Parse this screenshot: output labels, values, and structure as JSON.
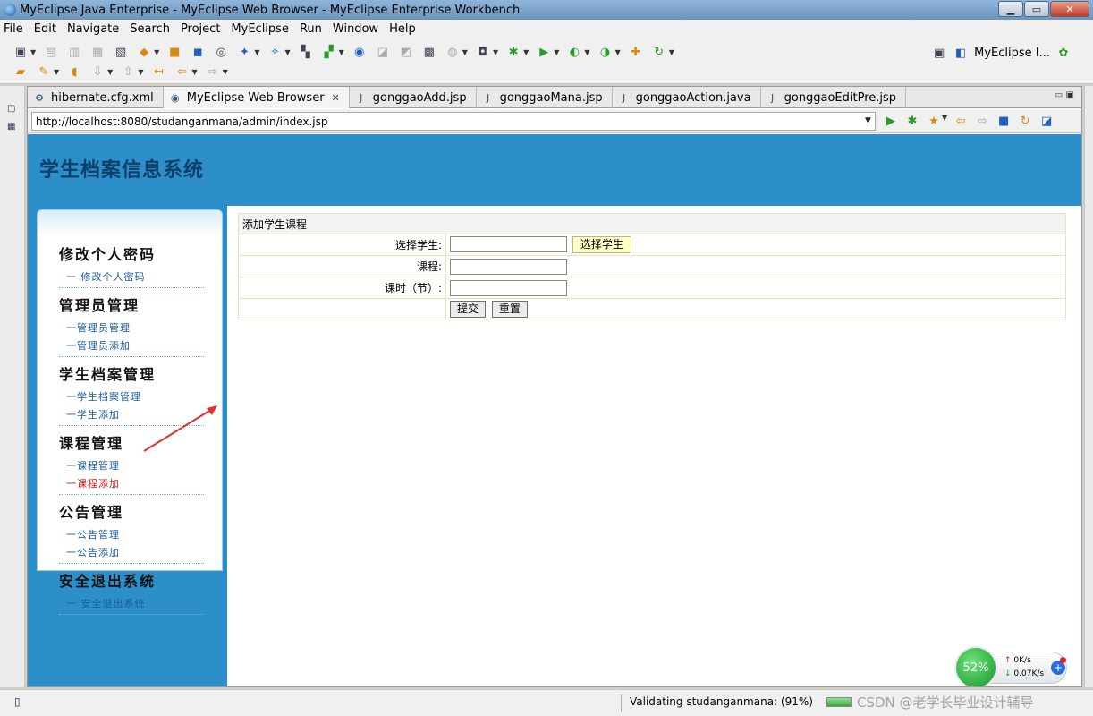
{
  "window": {
    "title": "MyEclipse Java Enterprise - MyEclipse Web Browser - MyEclipse Enterprise Workbench",
    "min_label": "▁",
    "max_label": "▭",
    "close_label": "✕"
  },
  "menu": [
    "File",
    "Edit",
    "Navigate",
    "Search",
    "Project",
    "MyEclipse",
    "Run",
    "Window",
    "Help"
  ],
  "perspective": {
    "label": "MyEclipse I..."
  },
  "tabs": [
    {
      "label": "hibernate.cfg.xml",
      "icon": "gear-icon"
    },
    {
      "label": "MyEclipse Web Browser",
      "icon": "globe-icon",
      "active": true
    },
    {
      "label": "gonggaoAdd.jsp",
      "icon": "jsp-file-icon"
    },
    {
      "label": "gonggaoMana.jsp",
      "icon": "jsp-file-icon"
    },
    {
      "label": "gonggaoAction.java",
      "icon": "java-file-icon"
    },
    {
      "label": "gonggaoEditPre.jsp",
      "icon": "jsp-file-icon"
    }
  ],
  "browser": {
    "url": "http://localhost:8080/studanganmana/admin/index.jsp"
  },
  "site": {
    "title": "学生档案信息系统"
  },
  "nav": {
    "sections": [
      {
        "title": "修改个人密码",
        "links": [
          {
            "label": "一  修改个人密码"
          }
        ]
      },
      {
        "title": "管理员管理",
        "links": [
          {
            "label": "一管理员管理"
          },
          {
            "label": "一管理员添加"
          }
        ]
      },
      {
        "title": "学生档案管理",
        "links": [
          {
            "label": "一学生档案管理"
          },
          {
            "label": "一学生添加"
          }
        ]
      },
      {
        "title": "课程管理",
        "links": [
          {
            "label": "一课程管理"
          },
          {
            "label": "一课程添加",
            "active": true
          }
        ]
      },
      {
        "title": "公告管理",
        "links": [
          {
            "label": "一公告管理"
          },
          {
            "label": "一公告添加"
          }
        ]
      },
      {
        "title": "安全退出系统",
        "links": [
          {
            "label": "一  安全退出系统"
          }
        ]
      }
    ]
  },
  "form": {
    "header": "添加学生课程",
    "student_label": "选择学生:",
    "student_value": "",
    "pick_button": "选择学生",
    "course_label": "课程:",
    "course_value": "",
    "hours_label": "课时（节）:",
    "hours_value": "",
    "submit_button": "提交",
    "reset_button": "重置"
  },
  "net_widget": {
    "cpu": "52%",
    "up": "0K/s",
    "down": "0.07K/s"
  },
  "status": {
    "text": "Validating studanganmana: (91%)",
    "watermark": "CSDN @老学长毕业设计辅导"
  },
  "colors": {
    "banner": "#2c8fc9",
    "site_title": "#0d3f6d",
    "nav_active": "#d81818",
    "pick_button": "#ffffc8"
  }
}
